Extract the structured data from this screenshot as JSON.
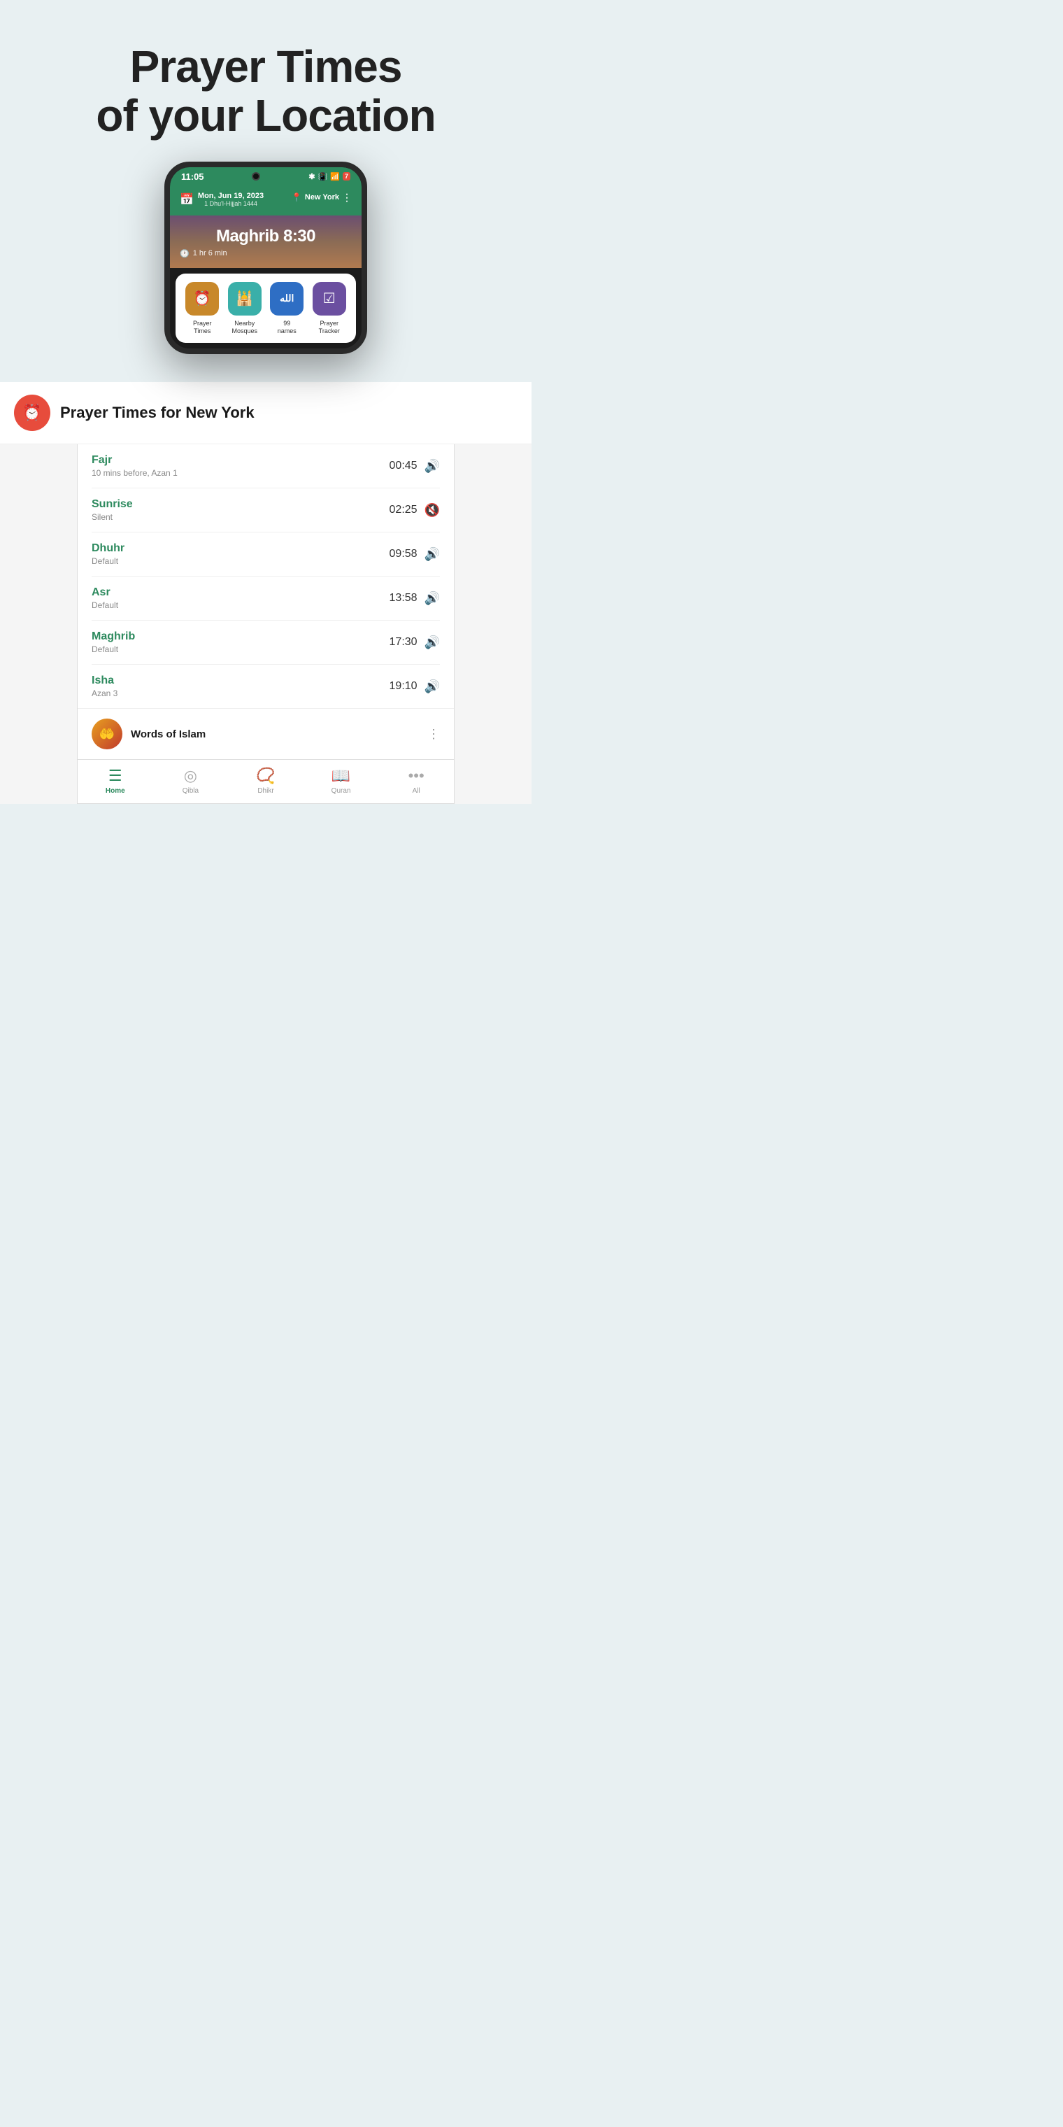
{
  "header": {
    "title_line1": "Prayer Times",
    "title_line2": "of your Location"
  },
  "phone1": {
    "status_time": "11:05",
    "date_text": "Mon, Jun 19, 2023",
    "hijri_text": "1 Dhu'l-Hijjah 1444",
    "location": "New York",
    "prayer_name": "Maghrib",
    "prayer_time": "8:30",
    "countdown": "1 hr 6 min",
    "actions": [
      {
        "label": "Prayer\nTimes",
        "icon": "⏰",
        "color_class": "icon-orange"
      },
      {
        "label": "Nearby\nMosques",
        "icon": "🕌",
        "color_class": "icon-teal"
      },
      {
        "label": "99\nnames",
        "icon": "الله",
        "color_class": "icon-blue"
      },
      {
        "label": "Prayer\nTracker",
        "icon": "☑",
        "color_class": "icon-purple"
      }
    ]
  },
  "section2": {
    "title": "Prayer Times for New York",
    "icon": "⏰"
  },
  "prayer_times": [
    {
      "name": "Fajr",
      "sub": "10 mins before, Azan 1",
      "time": "00:45",
      "sound": true
    },
    {
      "name": "Sunrise",
      "sub": "Silent",
      "time": "02:25",
      "sound": false
    },
    {
      "name": "Dhuhr",
      "sub": "Default",
      "time": "09:58",
      "sound": true
    },
    {
      "name": "Asr",
      "sub": "Default",
      "time": "13:58",
      "sound": true
    },
    {
      "name": "Maghrib",
      "sub": "Default",
      "time": "17:30",
      "sound": true
    },
    {
      "name": "Isha",
      "sub": "Azan 3",
      "time": "19:10",
      "sound": true
    }
  ],
  "words_of_islam": "Words of Islam",
  "bottom_nav": [
    {
      "label": "Home",
      "icon": "☰",
      "active": true
    },
    {
      "label": "Qibla",
      "icon": "◎",
      "active": false
    },
    {
      "label": "Dhikr",
      "icon": "📿",
      "active": false
    },
    {
      "label": "Quran",
      "icon": "📖",
      "active": false
    },
    {
      "label": "All",
      "icon": "···",
      "active": false
    }
  ]
}
